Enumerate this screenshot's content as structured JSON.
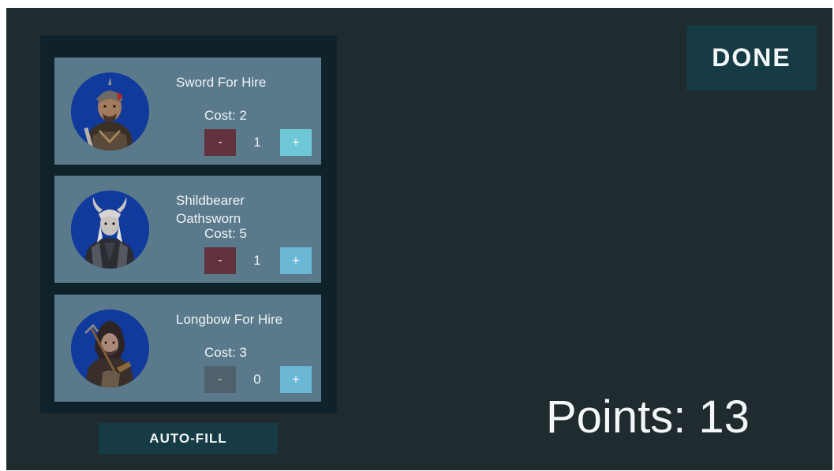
{
  "units": [
    {
      "name": "Sword For Hire",
      "cost": "Cost: 2",
      "quantity": "1",
      "minus_label": "-",
      "plus_label": "+",
      "portrait_icon": "sword-mercenary-portrait"
    },
    {
      "name": "Shildbearer Oathsworn",
      "cost": "Cost: 5",
      "quantity": "1",
      "minus_label": "-",
      "plus_label": "+",
      "portrait_icon": "horned-knight-portrait"
    },
    {
      "name": "Longbow For Hire",
      "cost": "Cost: 3",
      "quantity": "0",
      "minus_label": "-",
      "plus_label": "+",
      "portrait_icon": "hooded-archer-portrait"
    }
  ],
  "autofill_label": "AUTO-FILL",
  "done_label": "DONE",
  "points_text": "Points: 13",
  "colors": {
    "background": "#202b30",
    "panel": "#0f2129",
    "card": "#5a7a8c",
    "minus_active": "#62323d",
    "minus_disabled": "#4f616b",
    "plus": "#6ab8d6",
    "button": "#163b44",
    "portrait_bg": "#113a9d"
  }
}
